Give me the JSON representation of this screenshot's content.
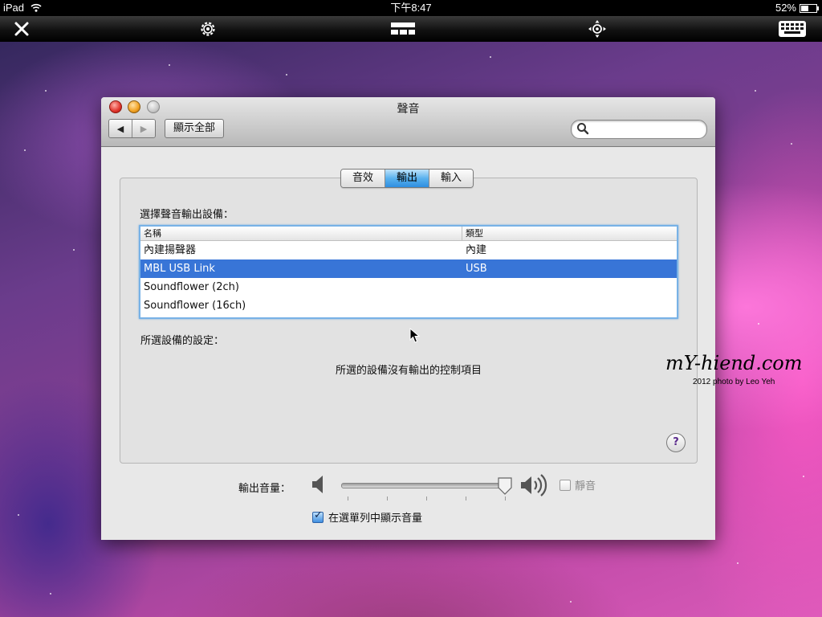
{
  "ipad": {
    "device": "iPad",
    "time": "下午8:47",
    "battery": "52%",
    "battery_level": 0.52
  },
  "toolbar": {
    "close_icon": "close-icon",
    "settings_icon": "gear-icon",
    "layout_icon": "screen-layout-icon",
    "move_icon": "move-icon",
    "keyboard_icon": "keyboard-icon"
  },
  "window": {
    "title": "聲音",
    "back_glyph": "◀",
    "forward_glyph": "▶",
    "show_all": "顯示全部",
    "search_placeholder": ""
  },
  "tabs": [
    {
      "label": "音效",
      "active": false
    },
    {
      "label": "輸出",
      "active": true
    },
    {
      "label": "輸入",
      "active": false
    }
  ],
  "output": {
    "choose_label": "選擇聲音輸出設備：",
    "columns": [
      "名稱",
      "類型"
    ],
    "devices": [
      {
        "name": "內建揚聲器",
        "type": "內建",
        "selected": false
      },
      {
        "name": "MBL USB Link",
        "type": "USB",
        "selected": true
      },
      {
        "name": "Soundflower (2ch)",
        "type": "",
        "selected": false
      },
      {
        "name": "Soundflower (16ch)",
        "type": "",
        "selected": false
      }
    ],
    "settings_label": "所選設備的設定：",
    "no_controls": "所選的設備沒有輸出的控制項目",
    "help": "?"
  },
  "volume": {
    "label": "輸出音量：",
    "level": 1.0,
    "mute_label": "靜音",
    "muted": false,
    "show_in_menubar_label": "在選單列中顯示音量",
    "show_in_menubar": true
  },
  "watermark": {
    "site": "mY-hiend.com",
    "credit": "2012  photo by Leo Yeh"
  },
  "colors": {
    "selection": "#3875d7",
    "tab_active": "#5ab2ee"
  }
}
